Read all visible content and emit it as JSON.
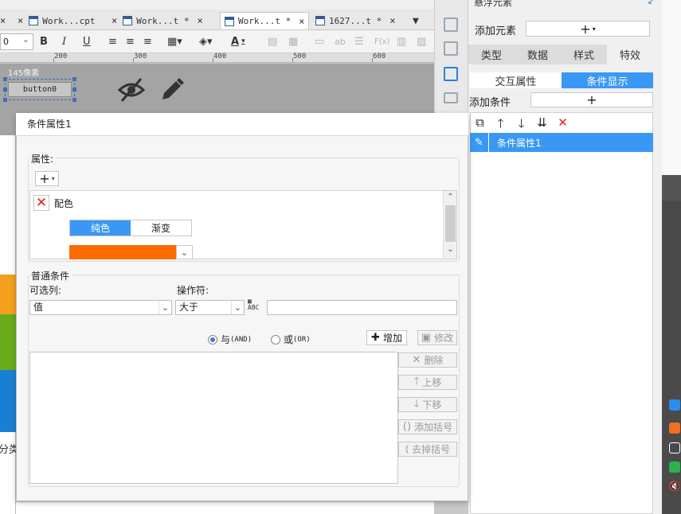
{
  "tabs": [
    {
      "label": "Work...cpt",
      "active": false
    },
    {
      "label": "Work...t *",
      "active": false
    },
    {
      "label": "Work...t *",
      "active": true
    },
    {
      "label": "1627...t *",
      "active": false
    }
  ],
  "tab_close_glyph": "×",
  "format_toolbar": {
    "font_size": "0",
    "bold": "B",
    "italic": "I",
    "underline": "U",
    "font_color_glyph": "A",
    "formula_glyph": "F(x)",
    "abbr_glyph": "ab"
  },
  "ruler": {
    "labels": [
      "200",
      "300",
      "400",
      "500",
      "600"
    ]
  },
  "canvas": {
    "pixel_label": "145像素",
    "button_text": "button0",
    "left_cutoff_label": "分类"
  },
  "right_panel": {
    "title": "悬浮元素",
    "add_element_label": "添加元素",
    "add_glyph": "+",
    "prop_tabs": [
      {
        "label": "类型",
        "active": false
      },
      {
        "label": "数据",
        "active": false
      },
      {
        "label": "样式",
        "active": false
      },
      {
        "label": "特效",
        "active": true
      }
    ],
    "sub_tabs": [
      {
        "label": "交互属性",
        "active": false
      },
      {
        "label": "条件显示",
        "active": true
      }
    ],
    "add_condition_label": "添加条件",
    "condition_item": "条件属性1"
  },
  "dialog": {
    "title": "条件属性1",
    "attr_group_label": "属性:",
    "attr_item_name": "配色",
    "color_modes": [
      {
        "label": "纯色",
        "active": true
      },
      {
        "label": "渐变",
        "active": false
      }
    ],
    "selected_color": "#ff6a00",
    "normal_group_label": "普通条件",
    "column_label": "可选列:",
    "column_value": "值",
    "operator_label": "操作符:",
    "operator_value": "大于",
    "abc_icon_text": "ABC",
    "value_input": "",
    "logic": [
      {
        "label": "与",
        "sub": "(AND)",
        "checked": true
      },
      {
        "label": "或",
        "sub": "(OR)",
        "checked": false
      }
    ],
    "buttons": {
      "add": "增加",
      "modify": "修改",
      "delete": "删除",
      "move_up": "上移",
      "move_down": "下移",
      "add_bracket": "添加括号",
      "remove_bracket": "去掉括号"
    }
  },
  "colors": {
    "accent": "#3a98f5",
    "delete_red": "#d8261f",
    "swatch": "#ff6a00",
    "canvas_bg": "#a4a4a4"
  }
}
